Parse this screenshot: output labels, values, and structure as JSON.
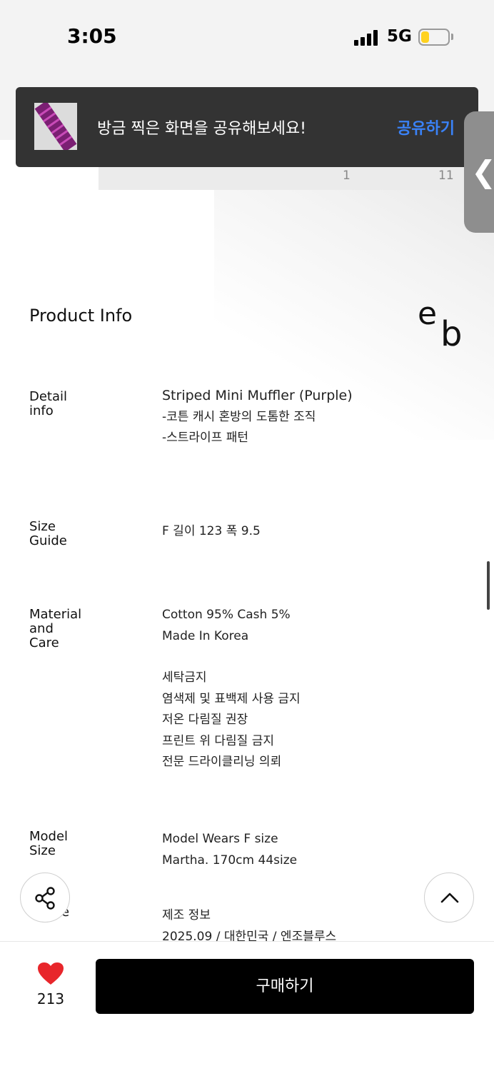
{
  "status_bar": {
    "time": "3:05",
    "network": "5G",
    "battery_level": 0.3
  },
  "tab_strip": {
    "count_1": "1",
    "count_2": "11"
  },
  "share_banner": {
    "message": "방금 찍은 화면을 공유해보세요!",
    "action": "공유하기"
  },
  "product_info": {
    "title": "Product Info",
    "brand_logo": "eb",
    "sections": [
      {
        "label": [
          "Detail",
          "info"
        ],
        "lines": [
          "Striped Mini Muffler (Purple)",
          "-코튼 캐시 혼방의 도톰한 조직",
          "-스트라이프 패턴"
        ]
      },
      {
        "label": [
          "Size",
          "Guide"
        ],
        "lines": [
          "F 길이 123  폭 9.5"
        ]
      },
      {
        "label": [
          "Material",
          "and",
          "Care"
        ],
        "lines": [
          "Cotton 95%  Cash 5%",
          "Made In Korea",
          "",
          "세탁금지",
          "염색제 및 표백제 사용 금지",
          "저온 다림질 권장",
          "프린트 위 다림질 금지",
          "전문 드라이클리닝 의뢰"
        ]
      },
      {
        "label": [
          "Model",
          "Size"
        ],
        "lines": [
          "Model Wears F size",
          "Martha. 170cm  44size"
        ]
      },
      {
        "label": [
          "e"
        ],
        "lines": [
          "제조 정보",
          "2025.09 / 대한민국 / 엔조블루스"
        ]
      }
    ]
  },
  "floating": {
    "share_icon": "share-icon",
    "top_icon": "chevron-up-icon"
  },
  "bottom_bar": {
    "like_count": "213",
    "buy_label": "구매하기",
    "heart_color": "#e8262b"
  },
  "colors": {
    "banner_bg": "#333333",
    "link_blue": "#3a82f7",
    "buy_bg": "#000000"
  }
}
